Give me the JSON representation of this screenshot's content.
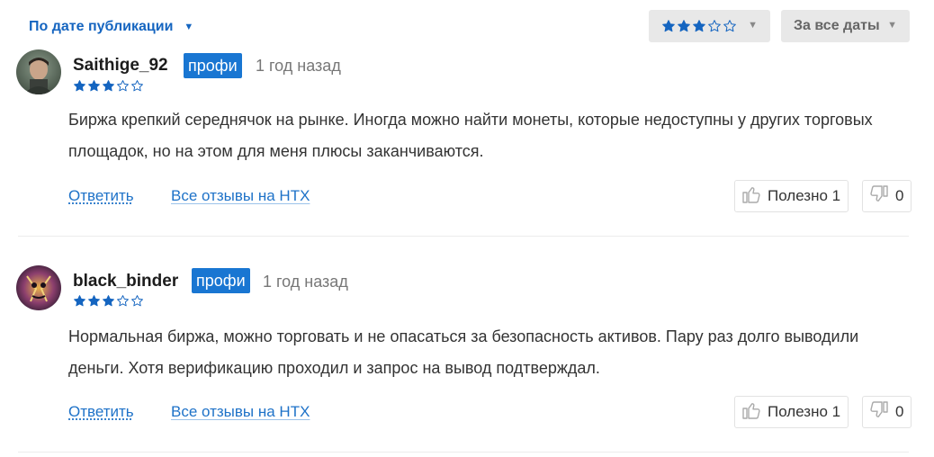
{
  "toolbar": {
    "sort_label": "По дате публикации",
    "sort_icon": "caret-down-icon",
    "rating_filter": {
      "rating": 3,
      "max": 5
    },
    "date_filter_label": "За все даты"
  },
  "colors": {
    "accent": "#1976d2",
    "link": "#1e72c8",
    "star": "#1565c0",
    "filter_bg": "#e8e8e8"
  },
  "reviews": [
    {
      "username": "Saithige_92",
      "badge": "профи",
      "time": "1 год назад",
      "rating": 3,
      "text": "Биржа крепкий середнячок на рынке. Иногда можно найти монеты, которые недоступны у других торговых площадок, но на этом для меня плюсы заканчиваются.",
      "reply_label": "Ответить",
      "all_reviews_label": "Все отзывы на HTX",
      "useful_label": "Полезно 1",
      "dislike_count": "0"
    },
    {
      "username": "black_binder",
      "badge": "профи",
      "time": "1 год назад",
      "rating": 3,
      "text": "Нормальная биржа, можно торговать и не опасаться за безопасность активов. Пару раз долго выводили деньги. Хотя верификацию проходил и запрос на вывод подтверждал.",
      "reply_label": "Ответить",
      "all_reviews_label": "Все отзывы на HTX",
      "useful_label": "Полезно 1",
      "dislike_count": "0"
    }
  ]
}
